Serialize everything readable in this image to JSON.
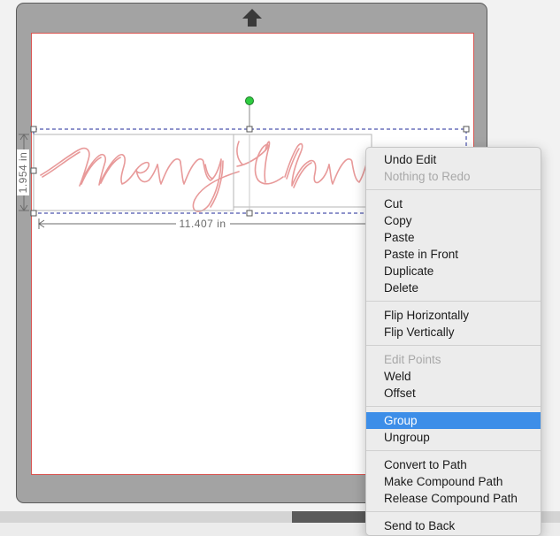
{
  "canvas": {
    "design_text": "Merry Christmas",
    "width_label": "11.407 in",
    "height_label": "1.954 in"
  },
  "context_menu": {
    "groups": [
      [
        {
          "label": "Undo Edit",
          "disabled": false
        },
        {
          "label": "Nothing to Redo",
          "disabled": true
        }
      ],
      [
        {
          "label": "Cut",
          "disabled": false
        },
        {
          "label": "Copy",
          "disabled": false
        },
        {
          "label": "Paste",
          "disabled": false
        },
        {
          "label": "Paste in Front",
          "disabled": false
        },
        {
          "label": "Duplicate",
          "disabled": false
        },
        {
          "label": "Delete",
          "disabled": false
        }
      ],
      [
        {
          "label": "Flip Horizontally",
          "disabled": false
        },
        {
          "label": "Flip Vertically",
          "disabled": false
        }
      ],
      [
        {
          "label": "Edit Points",
          "disabled": true
        },
        {
          "label": "Weld",
          "disabled": false
        },
        {
          "label": "Offset",
          "disabled": false
        }
      ],
      [
        {
          "label": "Group",
          "disabled": false,
          "selected": true
        },
        {
          "label": "Ungroup",
          "disabled": false
        }
      ],
      [
        {
          "label": "Convert to Path",
          "disabled": false
        },
        {
          "label": "Make Compound Path",
          "disabled": false
        },
        {
          "label": "Release Compound Path",
          "disabled": false
        }
      ],
      [
        {
          "label": "Send to Back",
          "disabled": false
        }
      ]
    ]
  },
  "colors": {
    "mat": "#a3a3a3",
    "canvas_border": "#d9534f",
    "selection_box": "#1f2a99",
    "rotate_handle": "#2ecc40",
    "menu_highlight": "#3d8ee8",
    "text_outline": "#e89a9a"
  }
}
